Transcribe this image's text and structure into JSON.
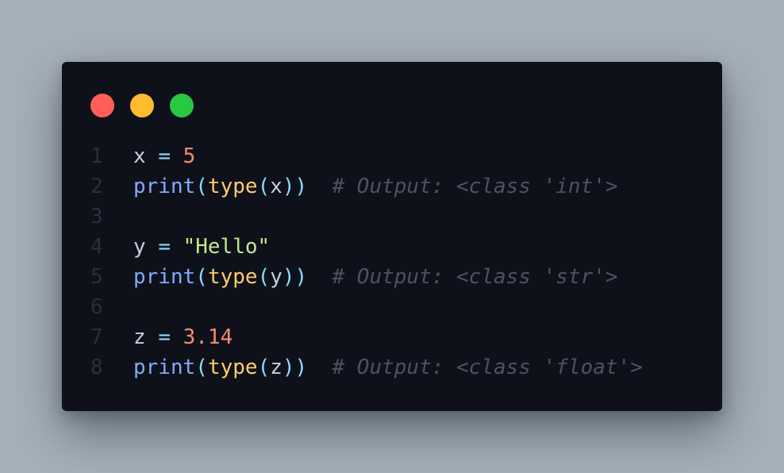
{
  "window": {
    "controls": [
      {
        "name": "close",
        "color": "#ff5f57"
      },
      {
        "name": "minimize",
        "color": "#febc2e"
      },
      {
        "name": "maximize",
        "color": "#28c840"
      }
    ]
  },
  "code": {
    "language": "python",
    "lines": [
      {
        "number": "1",
        "tokens": [
          {
            "t": "x",
            "k": "var"
          },
          {
            "t": " ",
            "k": "var"
          },
          {
            "t": "=",
            "k": "op"
          },
          {
            "t": " ",
            "k": "var"
          },
          {
            "t": "5",
            "k": "num"
          }
        ]
      },
      {
        "number": "2",
        "tokens": [
          {
            "t": "print",
            "k": "fn"
          },
          {
            "t": "(",
            "k": "paren"
          },
          {
            "t": "type",
            "k": "builtin"
          },
          {
            "t": "(",
            "k": "paren"
          },
          {
            "t": "x",
            "k": "var"
          },
          {
            "t": "))",
            "k": "paren"
          },
          {
            "t": "  ",
            "k": "var"
          },
          {
            "t": "# Output: <class 'int'>",
            "k": "comment"
          }
        ]
      },
      {
        "number": "3",
        "tokens": []
      },
      {
        "number": "4",
        "tokens": [
          {
            "t": "y",
            "k": "var"
          },
          {
            "t": " ",
            "k": "var"
          },
          {
            "t": "=",
            "k": "op"
          },
          {
            "t": " ",
            "k": "var"
          },
          {
            "t": "\"Hello\"",
            "k": "str"
          }
        ]
      },
      {
        "number": "5",
        "tokens": [
          {
            "t": "print",
            "k": "fn"
          },
          {
            "t": "(",
            "k": "paren"
          },
          {
            "t": "type",
            "k": "builtin"
          },
          {
            "t": "(",
            "k": "paren"
          },
          {
            "t": "y",
            "k": "var"
          },
          {
            "t": "))",
            "k": "paren"
          },
          {
            "t": "  ",
            "k": "var"
          },
          {
            "t": "# Output: <class 'str'>",
            "k": "comment"
          }
        ]
      },
      {
        "number": "6",
        "tokens": []
      },
      {
        "number": "7",
        "tokens": [
          {
            "t": "z",
            "k": "var"
          },
          {
            "t": " ",
            "k": "var"
          },
          {
            "t": "=",
            "k": "op"
          },
          {
            "t": " ",
            "k": "var"
          },
          {
            "t": "3.14",
            "k": "num"
          }
        ]
      },
      {
        "number": "8",
        "tokens": [
          {
            "t": "print",
            "k": "fn"
          },
          {
            "t": "(",
            "k": "paren"
          },
          {
            "t": "type",
            "k": "builtin"
          },
          {
            "t": "(",
            "k": "paren"
          },
          {
            "t": "z",
            "k": "var"
          },
          {
            "t": "))",
            "k": "paren"
          },
          {
            "t": "  ",
            "k": "var"
          },
          {
            "t": "# Output: <class 'float'>",
            "k": "comment"
          }
        ]
      }
    ]
  }
}
